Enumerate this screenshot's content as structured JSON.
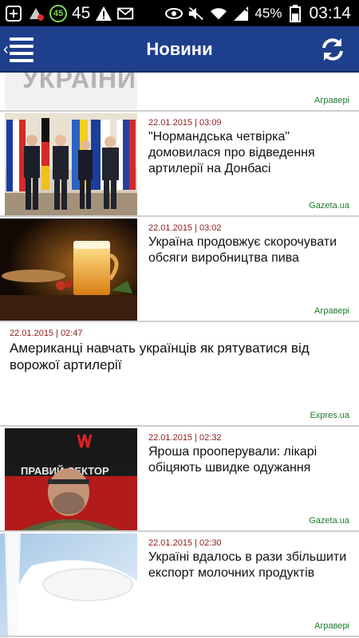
{
  "status_bar": {
    "left_icons": [
      "add-icon",
      "download-icon",
      "notification-45-icon",
      "warning-icon",
      "mail-icon"
    ],
    "notif_badge": "45",
    "notif_count": "45",
    "battery": "45%",
    "time": "03:14"
  },
  "app_bar": {
    "title": "Новини",
    "menu_icon": "menu-icon",
    "refresh_icon": "refresh-icon"
  },
  "partial_item": {
    "thumb_text": "УКРАЇНИ",
    "source": "Агравері"
  },
  "items": [
    {
      "datetime": "22.01.2015 | 03:09",
      "title": "\"Нормандська четвірка\" домовилася про відведення артилерії на Донбасі",
      "source": "Gazeta.ua",
      "thumb": "diplomats-photo"
    },
    {
      "datetime": "22.01.2015 | 03:02",
      "title": "Україна продовжує скорочувати обсяги виробництва пива",
      "source": "Агравері",
      "thumb": "beer-photo"
    },
    {
      "datetime": "22.01.2015 | 02:47",
      "title": "Американці навчать українців як рятуватися від ворожої артилерії",
      "source": "Expres.ua",
      "thumb": ""
    },
    {
      "datetime": "22.01.2015 | 02:32",
      "title": "Яроша прооперували: лікарі обіцяють швидке одужання",
      "source": "Gazeta.ua",
      "thumb": "portrait-photo"
    },
    {
      "datetime": "22.01.2015 | 02:30",
      "title": "Україні вдалось в рази збільшити експорт молочних продуктів",
      "source": "Агравері",
      "thumb": "milk-photo"
    }
  ],
  "colors": {
    "appbar": "#1e3f8c",
    "datetime": "#8b1a1a",
    "source": "#1b7a2a"
  }
}
